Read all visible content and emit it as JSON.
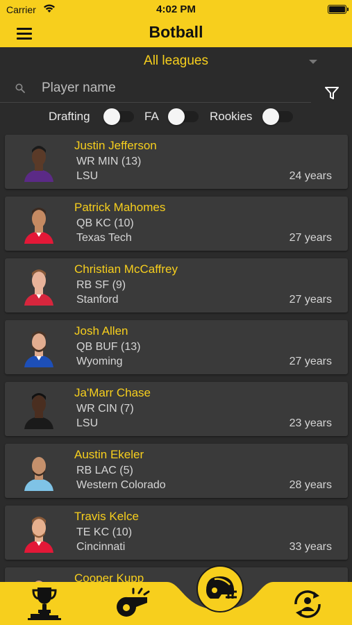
{
  "status": {
    "carrier": "Carrier",
    "time": "4:02 PM"
  },
  "header": {
    "title": "Botball"
  },
  "league": {
    "selected": "All leagues"
  },
  "search": {
    "placeholder": "Player name",
    "value": ""
  },
  "toggles": [
    {
      "label": "Drafting",
      "on": false
    },
    {
      "label": "FA",
      "on": false
    },
    {
      "label": "Rookies",
      "on": false
    }
  ],
  "players": [
    {
      "name": "Justin Jefferson",
      "position": "WR MIN (13)",
      "college": "LSU",
      "age": "24 years",
      "jersey": "#5b2a86"
    },
    {
      "name": "Patrick Mahomes",
      "position": "QB KC (10)",
      "college": "Texas Tech",
      "age": "27 years",
      "jersey": "#e31837"
    },
    {
      "name": "Christian McCaffrey",
      "position": "RB SF (9)",
      "college": "Stanford",
      "age": "27 years",
      "jersey": "#d7263d"
    },
    {
      "name": "Josh Allen",
      "position": "QB BUF (13)",
      "college": "Wyoming",
      "age": "27 years",
      "jersey": "#1d4fb8"
    },
    {
      "name": "Ja'Marr Chase",
      "position": "WR CIN (7)",
      "college": "LSU",
      "age": "23 years",
      "jersey": "#1a1a1a"
    },
    {
      "name": "Austin Ekeler",
      "position": "RB LAC (5)",
      "college": "Western Colorado",
      "age": "28 years",
      "jersey": "#7fc3e6"
    },
    {
      "name": "Travis Kelce",
      "position": "TE KC (10)",
      "college": "Cincinnati",
      "age": "33 years",
      "jersey": "#e31837"
    },
    {
      "name": "Cooper Kupp",
      "position": "",
      "college": "",
      "age": "",
      "jersey": "#1d4fb8"
    }
  ],
  "nav": {
    "items": [
      {
        "icon": "trophy-icon"
      },
      {
        "icon": "whistle-icon"
      },
      {
        "icon": "football-helmet-icon"
      },
      {
        "icon": "player-swap-icon"
      }
    ]
  },
  "colors": {
    "accent": "#f7cf1d",
    "background": "#2b2b2b",
    "card": "#3a3a3a"
  }
}
